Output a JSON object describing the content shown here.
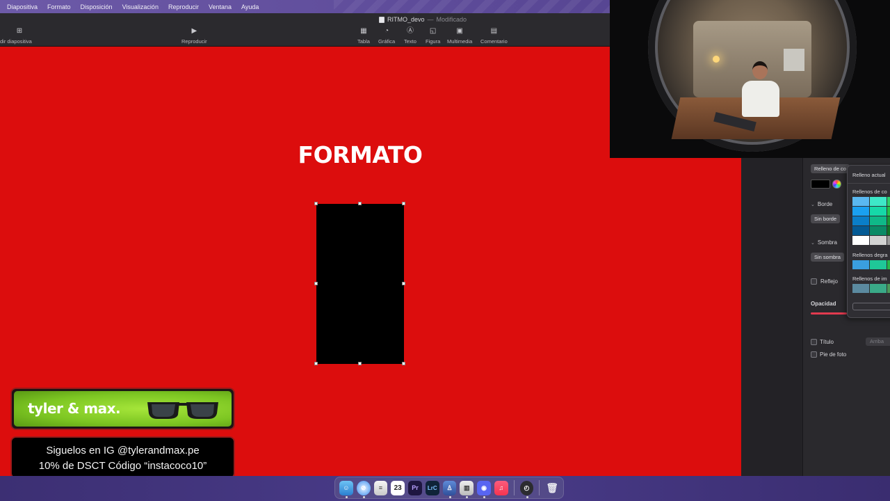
{
  "menubar": {
    "items": [
      "Diapositiva",
      "Formato",
      "Disposición",
      "Visualización",
      "Reproducir",
      "Ventana",
      "Ayuda"
    ]
  },
  "toolbar": {
    "doc_name": "RITMO_devo",
    "doc_separator": "—",
    "doc_status": "Modificado",
    "add_slide_label": "dir diapositiva",
    "play_label": "Reproducir",
    "tabla_label": "Tabla",
    "grafica_label": "Gráfica",
    "texto_label": "Texto",
    "figura_label": "Figura",
    "multimedia_label": "Multimedia",
    "comentario_label": "Comentario"
  },
  "slide": {
    "title": "FORMATO",
    "background_color": "#dc0d0d"
  },
  "inspector": {
    "fill_button": "Relleno de co",
    "border_section": "Borde",
    "border_value": "Sin borde",
    "shadow_section": "Sombra",
    "shadow_value": "Sin sombra",
    "reflection_label": "Reflejo",
    "opacity_label": "Opacidad",
    "title_label": "Título",
    "title_position": "Arriba",
    "caption_label": "Pie de foto"
  },
  "color_popover": {
    "current_fill": "Relleno actual",
    "color_fills": "Rellenos de co",
    "gradient_fills": "Rellenos degra",
    "image_fills": "Rellenos de im",
    "swatches": [
      "#5ab8f0",
      "#3ee8c8",
      "#2ecf6a",
      "#1aa0f0",
      "#16d8a8",
      "#22c24a",
      "#0a7ec8",
      "#0fb888",
      "#179a38",
      "#045a94",
      "#0a8a66",
      "#0f7428",
      "#ffffff",
      "#d2d2d2",
      "#9a9a9a"
    ],
    "gradient_swatches": [
      "#3a9ee0",
      "#1fc898",
      "#27b84a"
    ],
    "image_swatches": [
      "#5b8aa0",
      "#3aaa88",
      "#4a9a5a"
    ]
  },
  "sponsor": {
    "brand": "tyler & max.",
    "promo_line1": "Siguelos en IG @tylerandmax.pe",
    "promo_line2": "10% de DSCT Código “instacoco10”"
  },
  "dock": {
    "calendar_day": "23",
    "premiere_label": "Pr",
    "lightroom_label": "LrC"
  }
}
